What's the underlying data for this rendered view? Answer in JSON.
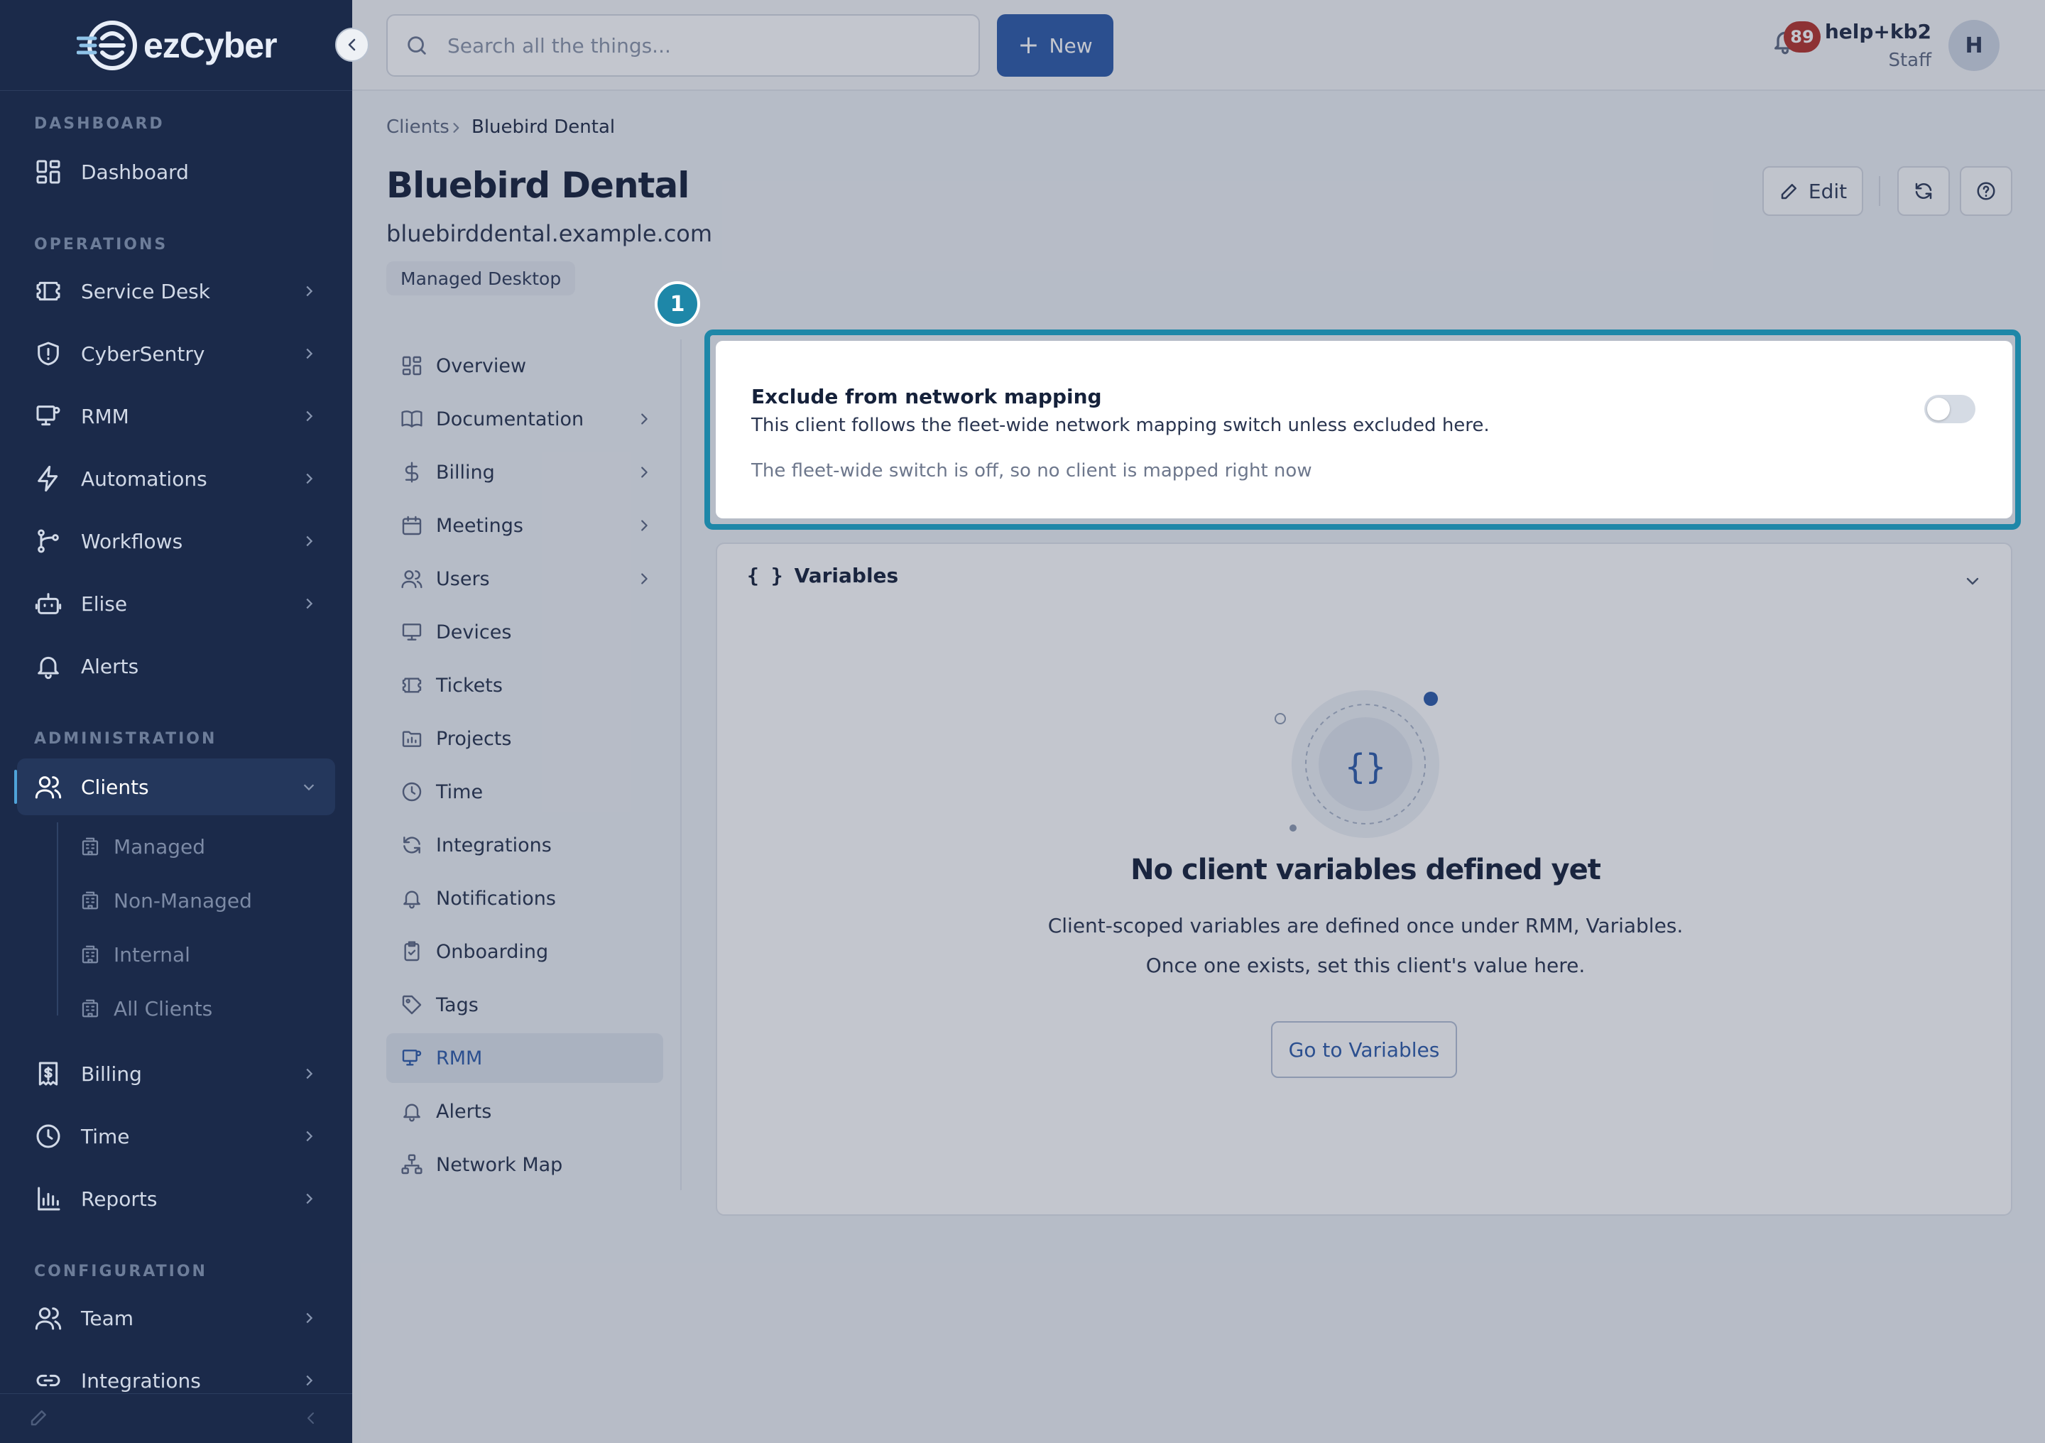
{
  "app": {
    "logo_text": "ezCyber"
  },
  "sidebar": {
    "sections": {
      "dashboard": "DASHBOARD",
      "operations": "OPERATIONS",
      "administration": "ADMINISTRATION",
      "configuration": "CONFIGURATION"
    },
    "items": {
      "dashboard": "Dashboard",
      "service_desk": "Service Desk",
      "cybersentry": "CyberSentry",
      "rmm": "RMM",
      "automations": "Automations",
      "workflows": "Workflows",
      "elise": "Elise",
      "alerts": "Alerts",
      "clients": "Clients",
      "billing": "Billing",
      "time": "Time",
      "reports": "Reports",
      "team": "Team",
      "integrations": "Integrations"
    },
    "clients_sub": [
      "Managed",
      "Non-Managed",
      "Internal",
      "All Clients"
    ]
  },
  "topbar": {
    "search_placeholder": "Search all the things...",
    "new_label": "New",
    "notification_count": "89",
    "user_name": "help+kb2",
    "user_role": "Staff",
    "avatar_initial": "H"
  },
  "breadcrumb": {
    "parent": "Clients",
    "current": "Bluebird Dental"
  },
  "client": {
    "name": "Bluebird Dental",
    "domain": "bluebirddental.example.com",
    "tag": "Managed Desktop",
    "edit_label": "Edit"
  },
  "client_nav": [
    "Overview",
    "Documentation",
    "Billing",
    "Meetings",
    "Users",
    "Devices",
    "Tickets",
    "Projects",
    "Time",
    "Integrations",
    "Notifications",
    "Onboarding",
    "Tags",
    "RMM",
    "Alerts",
    "Network Map"
  ],
  "network_card": {
    "title": "Exclude from network mapping",
    "description": "This client follows the fleet-wide network mapping switch unless excluded here.",
    "note": "The fleet-wide switch is off, so no client is mapped right now",
    "toggle_on": false
  },
  "variables": {
    "icon_text": "{ }",
    "title": "Variables",
    "empty_title": "No client variables defined yet",
    "empty_desc": "Client-scoped variables are defined once under RMM, Variables. Once one exists, set this client's value here.",
    "button_label": "Go to Variables"
  },
  "tutorial": {
    "step_number": "1"
  },
  "colors": {
    "sidebar_bg": "#1b2a4a",
    "primary": "#2d5ba8",
    "highlight": "#1e87a8",
    "badge": "#b5322a"
  }
}
